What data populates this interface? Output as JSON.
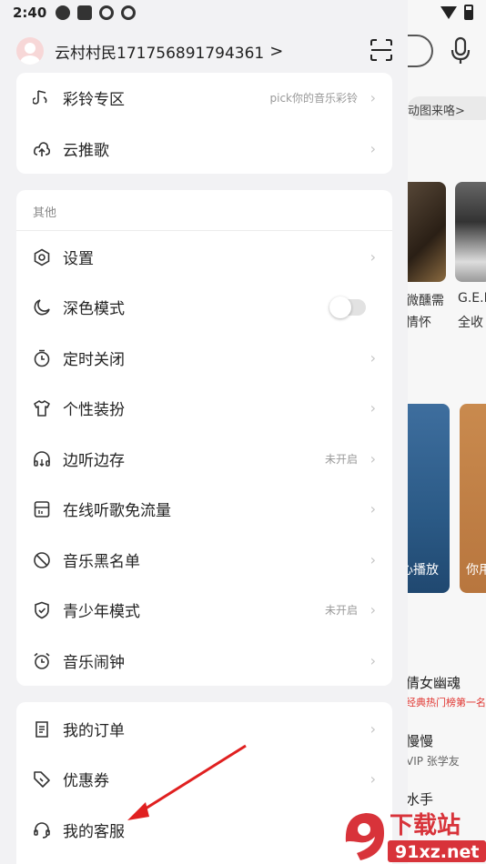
{
  "status_bar": {
    "time": "2:40"
  },
  "user": {
    "name": "云村村民17175689179436​1",
    "chevron": ">"
  },
  "card_top": {
    "items": [
      {
        "label": "彩铃专区",
        "hint": "pick你的音乐彩铃",
        "icon": "ringtone-icon"
      },
      {
        "label": "云推歌",
        "hint": "",
        "icon": "cloud-push-icon"
      }
    ]
  },
  "card_other": {
    "title": "其他",
    "items": [
      {
        "label": "设置",
        "hint": "",
        "icon": "settings-icon"
      },
      {
        "label": "深色模式",
        "hint": "",
        "icon": "moon-icon",
        "toggle": false
      },
      {
        "label": "定时关闭",
        "hint": "",
        "icon": "timer-icon"
      },
      {
        "label": "个性装扮",
        "hint": "",
        "icon": "tshirt-icon"
      },
      {
        "label": "边听边存",
        "hint": "未开启",
        "icon": "headphones-download-icon"
      },
      {
        "label": "在线听歌免流量",
        "hint": "",
        "icon": "sim-card-icon"
      },
      {
        "label": "音乐黑名单",
        "hint": "",
        "icon": "block-icon"
      },
      {
        "label": "青少年模式",
        "hint": "未开启",
        "icon": "shield-icon"
      },
      {
        "label": "音乐闹钟",
        "hint": "",
        "icon": "alarm-icon"
      }
    ]
  },
  "card_bottom": {
    "items": [
      {
        "label": "我的订单",
        "hint": "",
        "icon": "order-icon"
      },
      {
        "label": "优惠券",
        "hint": "",
        "icon": "coupon-icon"
      },
      {
        "label": "我的客服",
        "hint": "",
        "icon": "customer-service-icon"
      }
    ]
  },
  "background": {
    "banner": "动图来咯>",
    "card1_caption": [
      "微醺需",
      "情怀"
    ],
    "card2_caption": [
      "G.E.M",
      "全收"
    ],
    "card3_label": "心播放",
    "card4_label": "你用",
    "songs": [
      {
        "title": "倩女幽魂",
        "sub": "经典热门榜第一名"
      },
      {
        "title": "慢慢",
        "sub": "VIP 张学友"
      },
      {
        "title": "水手",
        "sub": ""
      }
    ]
  },
  "watermark": {
    "text": "91xz.net",
    "label": "下载站"
  },
  "colors": {
    "accent": "#e0342f",
    "arrow": "#e02020",
    "chevron": "#c4c4c4"
  }
}
